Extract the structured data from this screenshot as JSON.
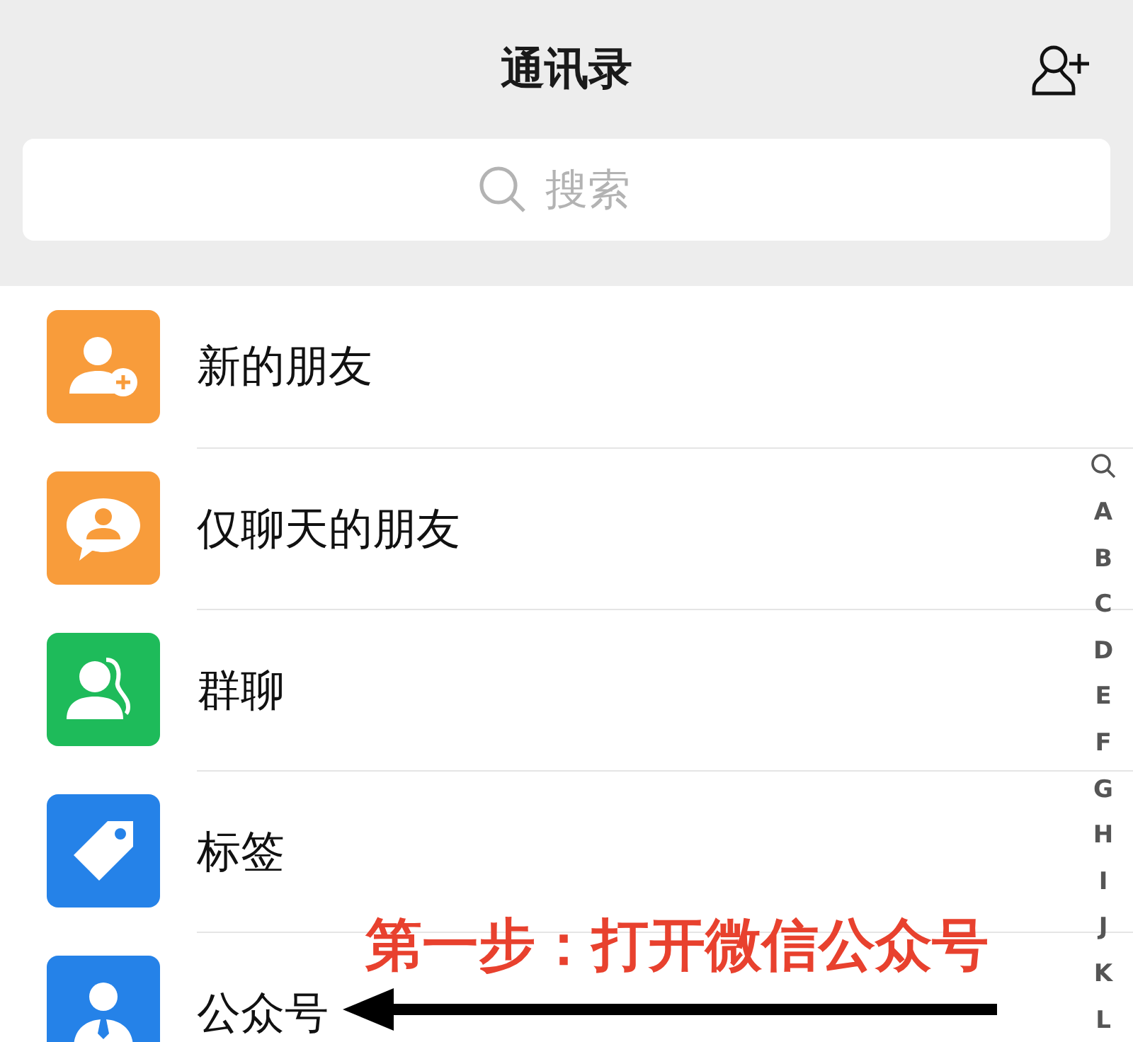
{
  "header": {
    "title": "通讯录"
  },
  "search": {
    "placeholder": "搜索"
  },
  "items": [
    {
      "label": "新的朋友",
      "kind": "add-person",
      "color": "#f89c3b"
    },
    {
      "label": "仅聊天的朋友",
      "kind": "chat-person",
      "color": "#f89c3b"
    },
    {
      "label": "群聊",
      "kind": "group",
      "color": "#1ebb5a"
    },
    {
      "label": "标签",
      "kind": "tag",
      "color": "#2582e8"
    },
    {
      "label": "公众号",
      "kind": "official",
      "color": "#2582e8"
    }
  ],
  "index": [
    "A",
    "B",
    "C",
    "D",
    "E",
    "F",
    "G",
    "H",
    "I",
    "J",
    "K",
    "L"
  ],
  "annotation": {
    "text": "第一步：打开微信公众号"
  }
}
